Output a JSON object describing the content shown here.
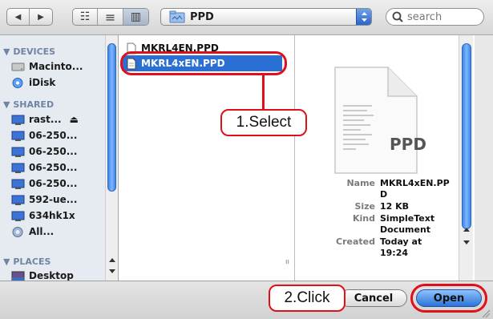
{
  "toolbar": {
    "back": "◀",
    "forward": "▶",
    "view_icons": "☷",
    "view_list": "≡",
    "view_columns": "▥",
    "path_popup": "PPD",
    "search_placeholder": "search"
  },
  "sidebar": {
    "devices_header": "DEVICES",
    "devices": [
      {
        "label": "Macinto...",
        "icon": "hard-disk-icon"
      },
      {
        "label": "iDisk",
        "icon": "idisk-icon"
      }
    ],
    "shared_header": "SHARED",
    "shared": [
      {
        "label": "rast...",
        "icon": "monitor-icon",
        "eject": "⏏"
      },
      {
        "label": "06-250...",
        "icon": "monitor-icon"
      },
      {
        "label": "06-250...",
        "icon": "monitor-icon"
      },
      {
        "label": "06-250...",
        "icon": "monitor-icon"
      },
      {
        "label": "06-250...",
        "icon": "monitor-icon"
      },
      {
        "label": "592-ue...",
        "icon": "monitor-icon"
      },
      {
        "label": "634hk1x",
        "icon": "monitor-icon"
      },
      {
        "label": "All...",
        "icon": "network-icon"
      }
    ],
    "places_header": "PLACES",
    "places": [
      {
        "label": "Desktop",
        "icon": "desktop-icon"
      }
    ]
  },
  "files": [
    {
      "name": "MKRL4EN.PPD",
      "selected": false
    },
    {
      "name": "MKRL4xEN.PPD",
      "selected": true
    }
  ],
  "preview": {
    "doc_label": "PPD",
    "name_key": "Name",
    "name_value_1": "MKRL4xEN.PP",
    "name_value_2": "D",
    "size_key": "Size",
    "size_value": "12 KB",
    "kind_key": "Kind",
    "kind_value_1": "SimpleText",
    "kind_value_2": "Document",
    "created_key": "Created",
    "created_value_1": "Today at",
    "created_value_2": "19:24"
  },
  "buttons": {
    "cancel": "Cancel",
    "open": "Open"
  },
  "annotations": {
    "select": "1.Select",
    "click": "2.Click"
  },
  "colors": {
    "accent_blue": "#2a6fd4",
    "annotation_red": "#e0101a"
  }
}
